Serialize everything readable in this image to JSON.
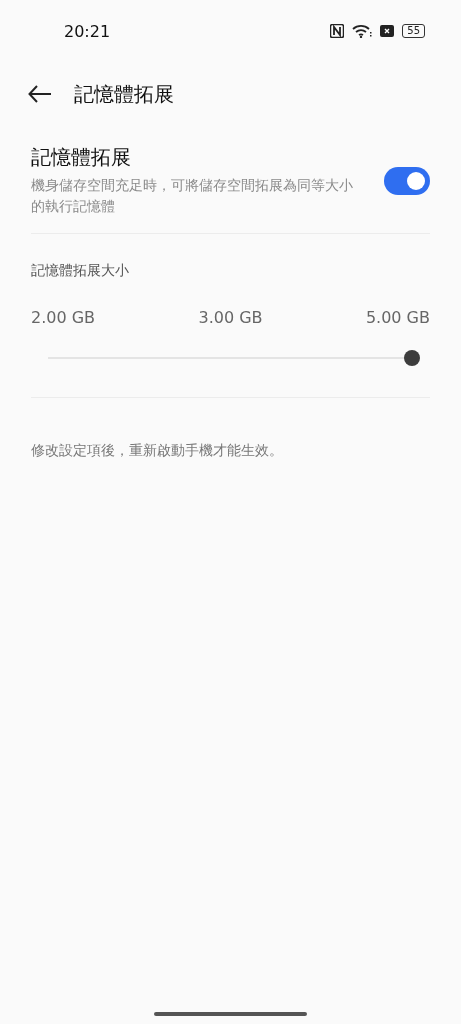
{
  "status_bar": {
    "time": "20:21",
    "battery": "55"
  },
  "header": {
    "title": "記憶體拓展"
  },
  "toggle": {
    "title": "記憶體拓展",
    "description": "機身儲存空間充足時，可將儲存空間拓展為同等大小的執行記憶體",
    "on": true
  },
  "size": {
    "label": "記憶體拓展大小",
    "ticks": [
      "2.00 GB",
      "3.00 GB",
      "5.00 GB"
    ],
    "level": 1
  },
  "note": "修改設定項後，重新啟動手機才能生效。"
}
